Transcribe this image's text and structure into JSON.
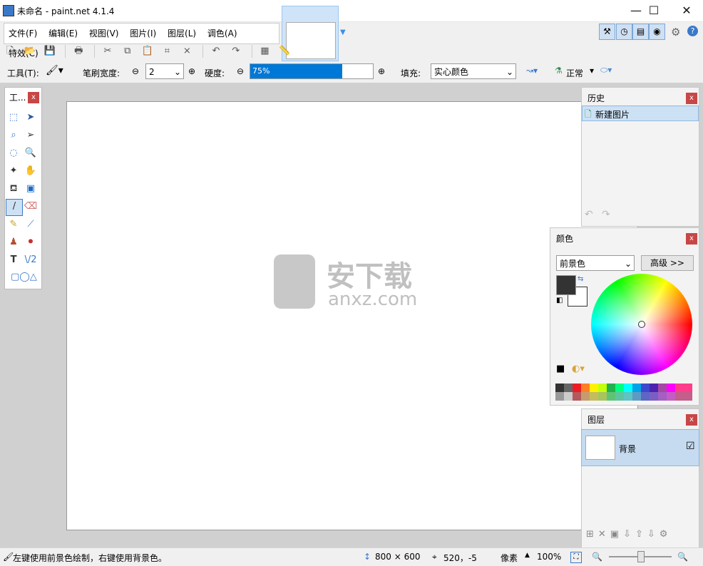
{
  "title_bar": {
    "title": "未命名 - paint.net 4.1.4",
    "minimize": "—",
    "maximize": "☐",
    "close": "✕"
  },
  "menu": [
    "文件(F)",
    "编辑(E)",
    "视图(V)",
    "图片(I)",
    "图层(L)",
    "调色(A)",
    "特效(C)"
  ],
  "toolbar2": {
    "tool_label": "工具(T):",
    "brush_width_label": "笔刷宽度:",
    "brush_width_value": "2",
    "hardness_label": "硬度:",
    "hardness_value": "75%",
    "hardness_fraction": 0.75,
    "fill_label": "填充:",
    "fill_value": "实心颜色",
    "blend_value": "正常"
  },
  "tools_panel": {
    "title": "工...",
    "close": "x"
  },
  "history_panel": {
    "title": "历史",
    "close": "x",
    "items": [
      "新建图片"
    ]
  },
  "colors_panel": {
    "title": "颜色",
    "close": "x",
    "selector_value": "前景色",
    "advanced_button": "高级 >>",
    "primary_color": "#333333",
    "secondary_color": "#ffffff"
  },
  "layers_panel": {
    "title": "图层",
    "close": "x",
    "layer_name": "背景"
  },
  "palette_top": [
    "#333333",
    "#666666",
    "#ed1c24",
    "#ff7f27",
    "#fff200",
    "#c4ff0e",
    "#22b14c",
    "#00ff80",
    "#00ffff",
    "#00a2e8",
    "#3f48cc",
    "#4d22b1",
    "#a349a4",
    "#ff00ff",
    "#ff3d8b",
    "#ff3d8b"
  ],
  "palette_bottom": [
    "#999999",
    "#cccccc",
    "#b5585c",
    "#c69c6d",
    "#c4bd5e",
    "#a7c45e",
    "#5ec475",
    "#5ec4a0",
    "#5ec4c4",
    "#5e9bc4",
    "#5e66c4",
    "#7b5ec4",
    "#a45ec4",
    "#c45ec4",
    "#c45e8b",
    "#c45e8b"
  ],
  "watermark": {
    "text_cn": "安下载",
    "text_en": "anxz.com"
  },
  "status": {
    "hint": "左键使用前景色绘制，右键使用背景色。",
    "image_size": "800 × 600",
    "cursor_pos": "520，-5",
    "unit": "像素",
    "zoom": "100%"
  }
}
